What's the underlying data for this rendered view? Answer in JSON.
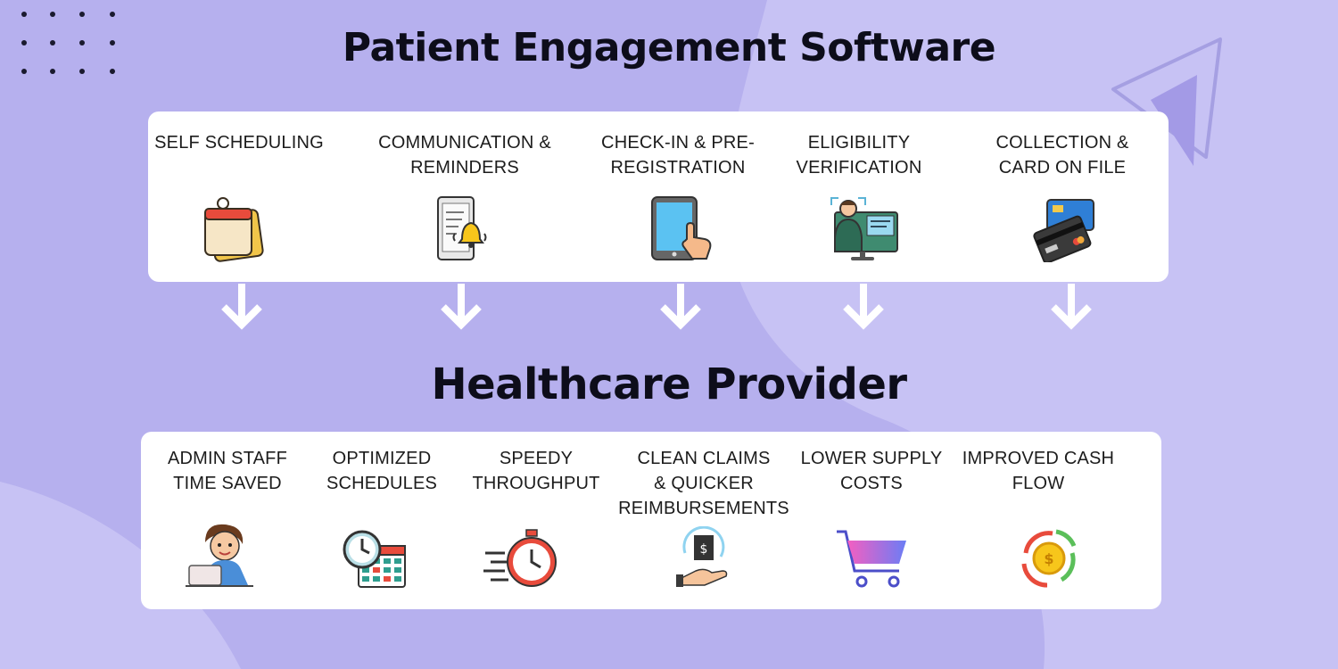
{
  "title": "Patient Engagement Software",
  "subtitle": "Healthcare Provider",
  "software_features": [
    {
      "label": "SELF SCHEDULING",
      "icon": "notepad-icon"
    },
    {
      "label": "COMMUNICATION &\nREMINDERS",
      "icon": "phone-bell-icon"
    },
    {
      "label": "CHECK-IN & PRE-\nREGISTRATION",
      "icon": "tablet-tap-icon"
    },
    {
      "label": "ELIGIBILITY\nVERIFICATION",
      "icon": "id-verification-icon"
    },
    {
      "label": "COLLECTION &\nCARD ON FILE",
      "icon": "credit-cards-icon"
    }
  ],
  "provider_benefits": [
    {
      "label": "ADMIN STAFF\nTIME SAVED",
      "icon": "staff-laptop-icon"
    },
    {
      "label": "OPTIMIZED\nSCHEDULES",
      "icon": "clock-calendar-icon"
    },
    {
      "label": "SPEEDY\nTHROUGHPUT",
      "icon": "stopwatch-icon"
    },
    {
      "label": "CLEAN CLAIMS\n& QUICKER\nREIMBURSEMENTS",
      "icon": "money-hand-icon"
    },
    {
      "label": "LOWER SUPPLY\nCOSTS",
      "icon": "shopping-cart-icon"
    },
    {
      "label": "IMPROVED CASH\nFLOW",
      "icon": "coin-cycle-icon"
    }
  ],
  "colors": {
    "background": "#b6b0ee",
    "card": "#ffffff",
    "heading": "#0d0d1a",
    "arrow": "#ffffff"
  }
}
